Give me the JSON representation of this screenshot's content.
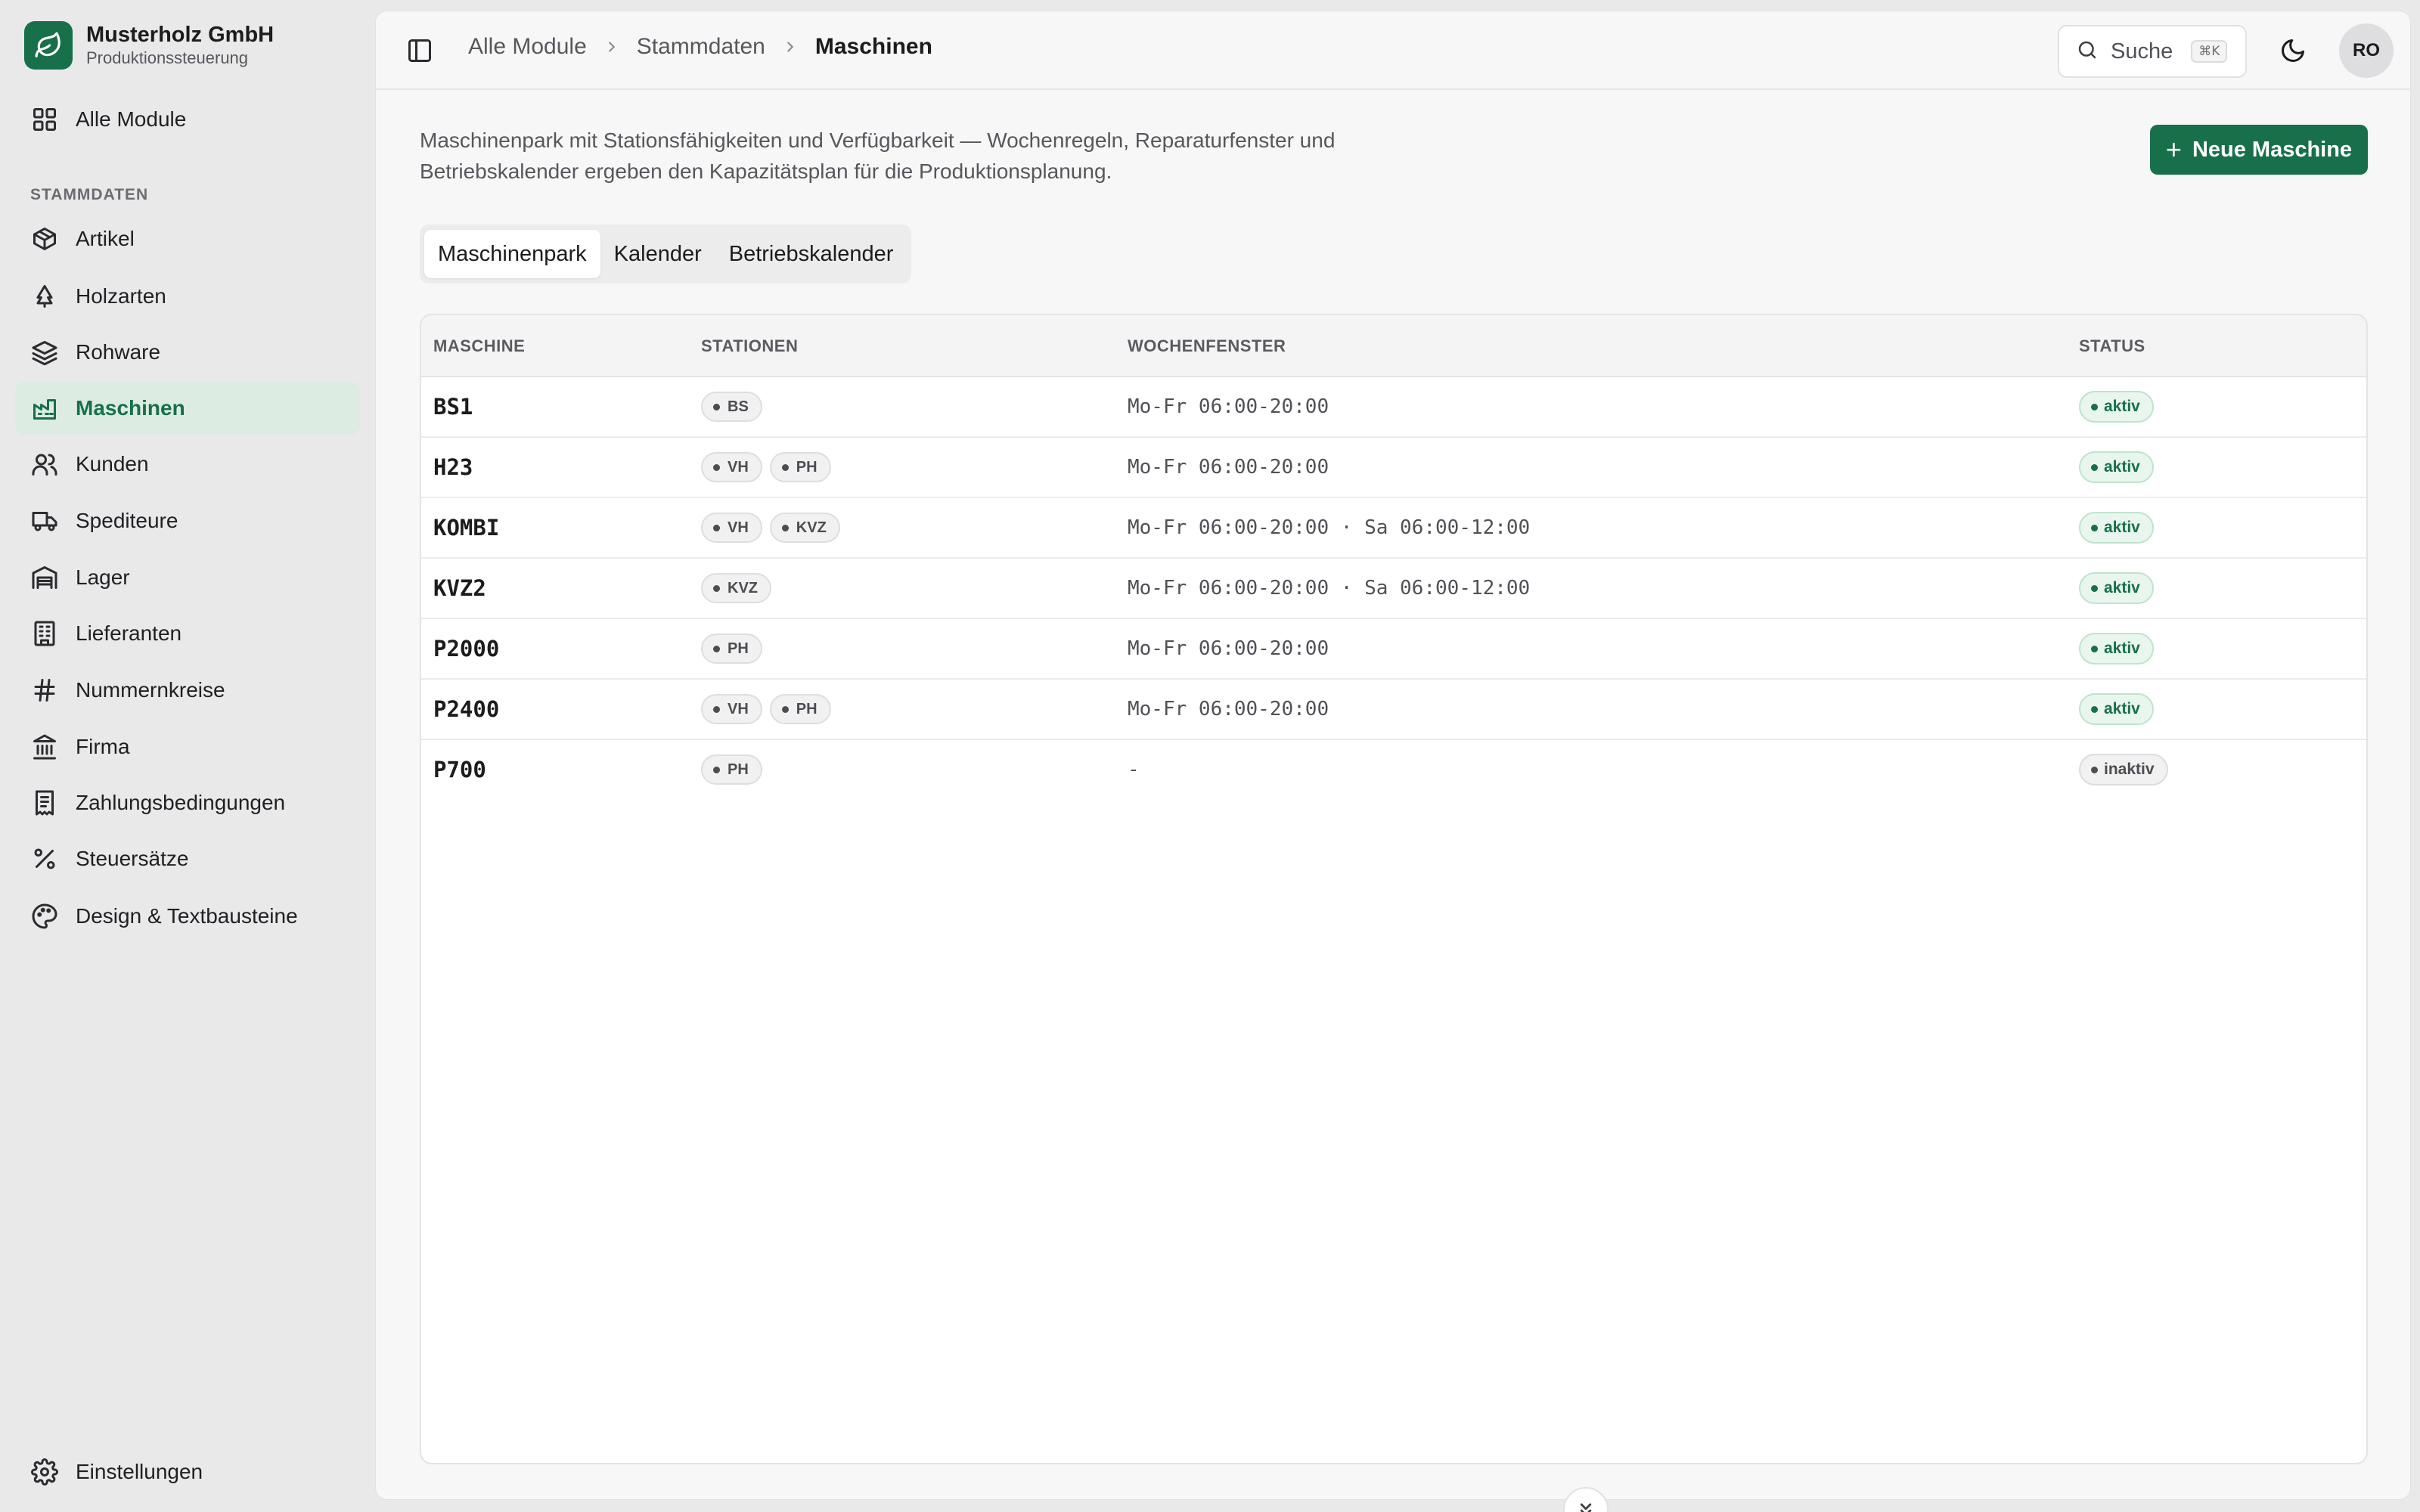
{
  "brand": {
    "name": "Musterholz GmbH",
    "subtitle": "Produktionssteuerung",
    "logo_icon": "leaf-icon",
    "accent": "#17704a"
  },
  "sidebar": {
    "top_item": {
      "label": "Alle Module",
      "icon": "grid-icon"
    },
    "section_label": "STAMMDATEN",
    "items": [
      {
        "label": "Artikel",
        "icon": "package-icon"
      },
      {
        "label": "Holzarten",
        "icon": "tree-icon"
      },
      {
        "label": "Rohware",
        "icon": "layers-icon"
      },
      {
        "label": "Maschinen",
        "icon": "factory-icon",
        "active": true
      },
      {
        "label": "Kunden",
        "icon": "users-icon"
      },
      {
        "label": "Spediteure",
        "icon": "truck-icon"
      },
      {
        "label": "Lager",
        "icon": "warehouse-icon"
      },
      {
        "label": "Lieferanten",
        "icon": "building-icon"
      },
      {
        "label": "Nummernkreise",
        "icon": "hash-icon"
      },
      {
        "label": "Firma",
        "icon": "landmark-icon"
      },
      {
        "label": "Zahlungsbedingungen",
        "icon": "receipt-icon"
      },
      {
        "label": "Steuersätze",
        "icon": "percent-icon"
      },
      {
        "label": "Design & Textbausteine",
        "icon": "palette-icon"
      }
    ],
    "bottom_item": {
      "label": "Einstellungen",
      "icon": "gear-icon"
    }
  },
  "topbar": {
    "breadcrumb": [
      "Alle Module",
      "Stammdaten",
      "Maschinen"
    ],
    "search_placeholder": "Suche",
    "search_shortcut": "⌘K",
    "avatar_initials": "RO"
  },
  "page": {
    "description": "Maschinenpark mit Stationsfähigkeiten und Verfügbarkeit — Wochenregeln, Reparaturfenster und Betriebskalender ergeben den Kapazitätsplan für die Produktionsplanung.",
    "primary_action": "Neue Maschine",
    "tabs": [
      "Maschinenpark",
      "Kalender",
      "Betriebskalender"
    ],
    "active_tab": "Maschinenpark"
  },
  "table": {
    "columns": [
      "MASCHINE",
      "STATIONEN",
      "WOCHENFENSTER",
      "STATUS"
    ],
    "rows": [
      {
        "name": "BS1",
        "stations": [
          "BS"
        ],
        "window": "Mo-Fr 06:00-20:00",
        "status": "aktiv"
      },
      {
        "name": "H23",
        "stations": [
          "VH",
          "PH"
        ],
        "window": "Mo-Fr 06:00-20:00",
        "status": "aktiv"
      },
      {
        "name": "KOMBI",
        "stations": [
          "VH",
          "KVZ"
        ],
        "window": "Mo-Fr 06:00-20:00 · Sa 06:00-12:00",
        "status": "aktiv"
      },
      {
        "name": "KVZ2",
        "stations": [
          "KVZ"
        ],
        "window": "Mo-Fr 06:00-20:00 · Sa 06:00-12:00",
        "status": "aktiv"
      },
      {
        "name": "P2000",
        "stations": [
          "PH"
        ],
        "window": "Mo-Fr 06:00-20:00",
        "status": "aktiv"
      },
      {
        "name": "P2400",
        "stations": [
          "VH",
          "PH"
        ],
        "window": "Mo-Fr 06:00-20:00",
        "status": "aktiv"
      },
      {
        "name": "P700",
        "stations": [
          "PH"
        ],
        "window": "-",
        "status": "inaktiv"
      }
    ]
  }
}
